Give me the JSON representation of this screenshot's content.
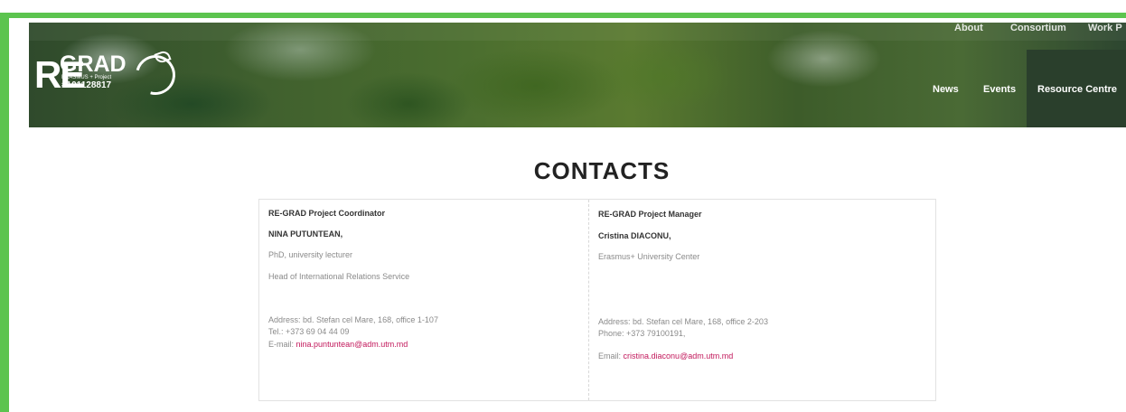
{
  "nav": {
    "top_items": [
      "About",
      "Consortium",
      "Work P"
    ],
    "main_items": [
      "News",
      "Events"
    ],
    "resource_centre": "Resource Centre"
  },
  "logo": {
    "re": "RE",
    "grad": "GRAD",
    "subtitle": "ERASMUS + Project",
    "number": "#101128817"
  },
  "page": {
    "title": "CONTACTS"
  },
  "contacts": [
    {
      "role": "RE-GRAD Project Coordinator",
      "name": "NINA PUTUNTEAN,",
      "lines": [
        "PhD, university lecturer",
        "Head of International Relations Service"
      ],
      "address": "Address: bd. Stefan cel Mare, 168, office 1-107",
      "phone": "Tel.: +373 69 04 44 09",
      "email_label": "E-mail:",
      "email": "nina.puntuntean@adm.utm.md"
    },
    {
      "role": "RE-GRAD Project Manager",
      "name": "Cristina DIACONU,",
      "lines": [
        "Erasmus+ University Center"
      ],
      "address": "Address: bd. Stefan cel Mare, 168, office 2-203",
      "phone": "Phone: +373 79100191,",
      "email_label": "Email:",
      "email": "cristina.diaconu@adm.utm.md"
    }
  ],
  "colors": {
    "frame_green": "#5cc44f",
    "email_link": "#c2185b",
    "resource_box": "#2a3f2c"
  }
}
